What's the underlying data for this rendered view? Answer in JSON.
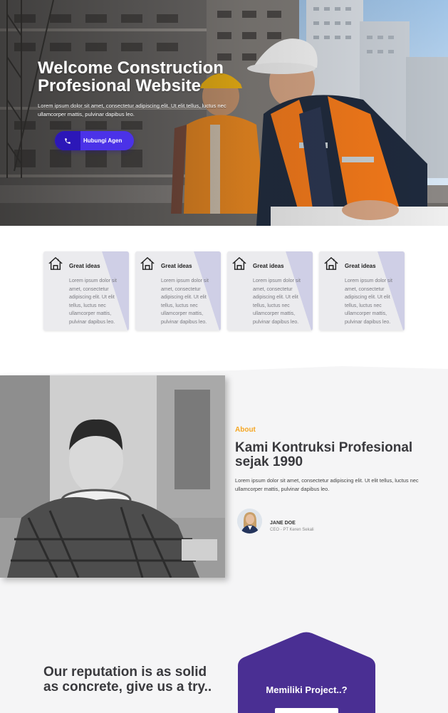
{
  "hero": {
    "title_line1": "Welcome Construction",
    "title_line2": "Profesional Website",
    "subtitle": "Lorem ipsum dolor sit amet, consectetur adipiscing elit. Ut elit tellus, luctus nec ullamcorper mattis, pulvinar dapibus leo.",
    "cta_label": "Hubungi Agen",
    "cta_icon": "phone-icon"
  },
  "features": [
    {
      "icon": "house-icon",
      "title": "Great ideas",
      "text": "Lorem ipsum dolor sit amet, consectetur adipiscing elit. Ut elit tellus, luctus nec ullamcorper mattis, pulvinar dapibus leo."
    },
    {
      "icon": "house-icon",
      "title": "Great ideas",
      "text": "Lorem ipsum dolor sit amet, consectetur adipiscing elit. Ut elit tellus, luctus nec ullamcorper mattis, pulvinar dapibus leo."
    },
    {
      "icon": "house-icon",
      "title": "Great ideas",
      "text": "Lorem ipsum dolor sit amet, consectetur adipiscing elit. Ut elit tellus, luctus nec ullamcorper mattis, pulvinar dapibus leo."
    },
    {
      "icon": "house-icon",
      "title": "Great ideas",
      "text": "Lorem ipsum dolor sit amet, consectetur adipiscing elit. Ut elit tellus, luctus nec ullamcorper mattis, pulvinar dapibus leo."
    }
  ],
  "about": {
    "kicker": "About",
    "title": "Kami Kontruksi Profesional sejak 1990",
    "description": "Lorem ipsum dolor sit amet, consectetur adipiscing elit. Ut elit tellus, luctus nec ullamcorper mattis, pulvinar dapibus leo.",
    "person_name": "JANE DOE",
    "person_role": "CEO - PT Keren Sekali"
  },
  "reputation": {
    "title": "Our reputation is as solid as concrete, give us a try.."
  },
  "cta": {
    "title": "Memiliki Project..?"
  },
  "colors": {
    "accent": "#4b32e8",
    "accent_dark": "#2c17b8",
    "kicker": "#f5a623",
    "cta_card": "#4a2f93",
    "card_stripe": "#cfcfe6"
  }
}
